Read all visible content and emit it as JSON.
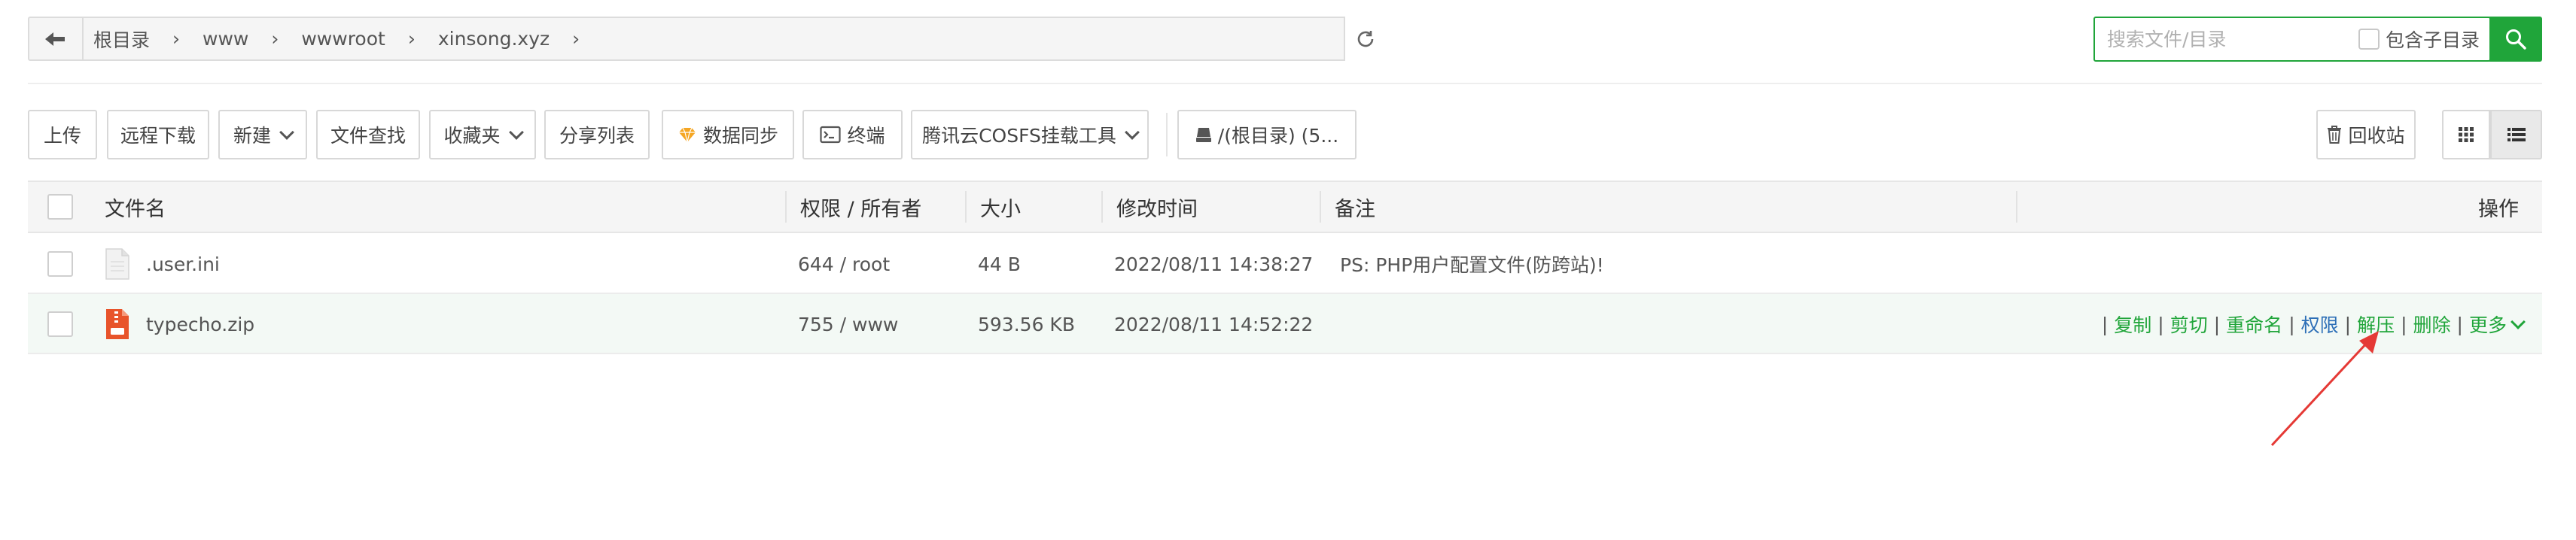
{
  "breadcrumb": [
    "根目录",
    "www",
    "wwwroot",
    "xinsong.xyz"
  ],
  "search": {
    "placeholder": "搜索文件/目录",
    "subdir_label": "包含子目录"
  },
  "toolbar": {
    "upload": "上传",
    "remote_download": "远程下载",
    "new": "新建",
    "find": "文件查找",
    "favorites": "收藏夹",
    "share_list": "分享列表",
    "sync": "数据同步",
    "terminal": "终端",
    "cosfs": "腾讯云COSFS挂载工具",
    "disk": "/(根目录) (5...",
    "recycle": "回收站"
  },
  "table": {
    "headers": {
      "name": "文件名",
      "perm": "权限 / 所有者",
      "size": "大小",
      "mtime": "修改时间",
      "note": "备注",
      "ops": "操作"
    },
    "rows": [
      {
        "name": ".user.ini",
        "perm": "644 / root",
        "size": "44 B",
        "mtime": "2022/08/11 14:38:27",
        "note": "PS: PHP用户配置文件(防跨站)!"
      },
      {
        "name": "typecho.zip",
        "perm": "755 / www",
        "size": "593.56 KB",
        "mtime": "2022/08/11 14:52:22",
        "note": ""
      }
    ],
    "row_ops": [
      "复制",
      "剪切",
      "重命名",
      "权限",
      "解压",
      "删除",
      "更多"
    ]
  },
  "colors": {
    "accent": "#20a53a",
    "perm_link": "#2d6fb7",
    "arrow": "#e53935",
    "zip_icon": "#e8542b"
  }
}
